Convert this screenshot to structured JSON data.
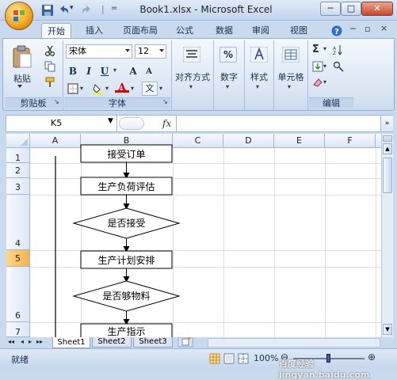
{
  "window": {
    "title": "Book1.xlsx - Microsoft Excel",
    "minimize": "─",
    "maximize": "□",
    "close": "✕"
  },
  "qat": {
    "undo_arrow": "▾",
    "separator": "|",
    "customize": "="
  },
  "tabs": [
    "开始",
    "插入",
    "页面布局",
    "公式",
    "数据",
    "审阅",
    "视图"
  ],
  "ribbon": {
    "clipboard": {
      "paste_label": "粘贴",
      "group_label": "剪贴板"
    },
    "font": {
      "font_name": "宋体",
      "font_size": "12",
      "bold": "B",
      "italic": "I",
      "underline": "U",
      "grow": "A",
      "shrink": "A",
      "font_color_letter": "A",
      "phonetic": "文",
      "group_label": "字体"
    },
    "alignment": {
      "label": "对齐方式"
    },
    "number": {
      "label": "数字",
      "percent": "%"
    },
    "styles": {
      "label": "样式"
    },
    "cells": {
      "label": "单元格"
    },
    "editing": {
      "group_label": "编辑",
      "sigma": "Σ"
    }
  },
  "formula_bar": {
    "name_box": "K5",
    "fx": "fx",
    "formula": ""
  },
  "columns": [
    "A",
    "B",
    "C",
    "D",
    "E",
    "F"
  ],
  "rows": [
    "1",
    "2",
    "3",
    "4",
    "5",
    "6",
    "7"
  ],
  "selected_row": "5",
  "flowchart": {
    "step1": "接受订单",
    "step2": "生产负荷评估",
    "decision1": "是否接受",
    "step3": "生产计划安排",
    "decision2": "是否够物料",
    "step4": "生产指示"
  },
  "sheet_tabs": [
    "Sheet1",
    "Sheet2",
    "Sheet3"
  ],
  "status": {
    "ready": "就绪",
    "zoom": "100%"
  },
  "watermark": "百度经验 jingyan.baidu.com",
  "colors": {
    "accent": "#c9d9ee",
    "selected_row": "#f6b34d"
  }
}
